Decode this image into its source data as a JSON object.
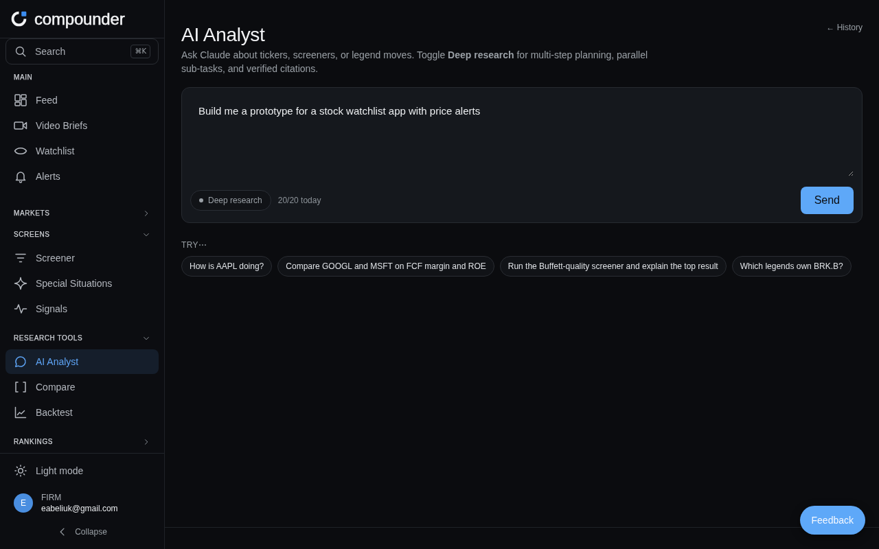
{
  "brand": {
    "name": "compounder"
  },
  "search": {
    "placeholder": "Search",
    "shortcut": "⌘K"
  },
  "nav_sections": [
    {
      "label": "MAIN",
      "kind": "plain",
      "items": [
        {
          "label": "Feed",
          "selected": false
        },
        {
          "label": "Video Briefs",
          "selected": false
        },
        {
          "label": "Watchlist",
          "selected": false
        },
        {
          "label": "Alerts",
          "selected": false
        }
      ]
    },
    {
      "label": "MARKETS",
      "kind": "collapsible",
      "expanded": false
    },
    {
      "label": "SCREENS",
      "kind": "collapsible",
      "expanded": true,
      "items": [
        {
          "label": "Screener",
          "selected": false
        },
        {
          "label": "Special Situations",
          "selected": false
        },
        {
          "label": "Signals",
          "selected": false
        }
      ]
    },
    {
      "label": "RESEARCH TOOLS",
      "kind": "collapsible",
      "expanded": true,
      "items": [
        {
          "label": "AI Analyst",
          "selected": true
        },
        {
          "label": "Compare",
          "selected": false
        },
        {
          "label": "Backtest",
          "selected": false
        }
      ]
    },
    {
      "label": "RANKINGS",
      "kind": "collapsible",
      "expanded": false
    }
  ],
  "theme_toggle": {
    "label": "Light mode"
  },
  "user": {
    "initial": "E",
    "plan": "FIRM",
    "email": "eabeliuk@gmail.com"
  },
  "collapse": {
    "label": "Collapse"
  },
  "page": {
    "title": "AI Analyst",
    "description": "Ask Claude about tickers, screeners, or legend moves. Toggle **Deep research** for multi-step planning, parallel sub-tasks, and verified citations.",
    "history_link": "← History"
  },
  "composer": {
    "value": "Build me a prototype for a stock watchlist app with price alerts",
    "deep_research": {
      "label": "Deep research",
      "on": false
    },
    "usage": "20/20 today",
    "send": "Send"
  },
  "suggestions": {
    "label": "TRY⋯",
    "chips": [
      "How is AAPL doing?",
      "Compare GOOGL and MSFT on FCF margin and ROE",
      "Run the Buffett-quality screener and explain the top result",
      "Which legends own BRK.B?"
    ]
  },
  "feedback": "Feedback"
}
